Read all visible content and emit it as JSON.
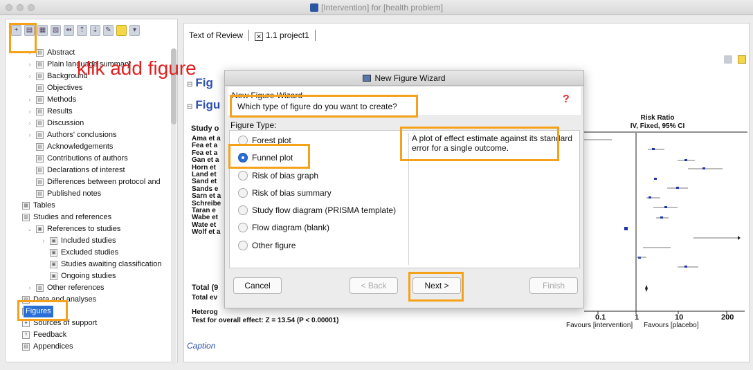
{
  "window": {
    "title": "[Intervention] for [health problem]"
  },
  "annotation": "klik add figure",
  "tabs": [
    {
      "label": "Text of Review"
    },
    {
      "label": "1.1 project1"
    }
  ],
  "tree": [
    {
      "label": "Abstract",
      "icon": "section-icon",
      "level": 1,
      "chevron": ">"
    },
    {
      "label": "Plain language summary",
      "icon": "section-icon",
      "level": 1,
      "chevron": ">"
    },
    {
      "label": "Background",
      "icon": "section-icon",
      "level": 1,
      "chevron": ">"
    },
    {
      "label": "Objectives",
      "icon": "section-icon",
      "level": 1,
      "chevron": ""
    },
    {
      "label": "Methods",
      "icon": "section-icon",
      "level": 1,
      "chevron": ">"
    },
    {
      "label": "Results",
      "icon": "section-icon",
      "level": 1,
      "chevron": ">"
    },
    {
      "label": "Discussion",
      "icon": "section-icon",
      "level": 1,
      "chevron": ">"
    },
    {
      "label": "Authors' conclusions",
      "icon": "section-icon",
      "level": 1,
      "chevron": ">"
    },
    {
      "label": "Acknowledgements",
      "icon": "section-icon",
      "level": 1,
      "chevron": ""
    },
    {
      "label": "Contributions of authors",
      "icon": "section-icon",
      "level": 1,
      "chevron": ""
    },
    {
      "label": "Declarations of interest",
      "icon": "section-icon",
      "level": 1,
      "chevron": ""
    },
    {
      "label": "Differences between protocol and",
      "icon": "section-icon",
      "level": 1,
      "chevron": ""
    },
    {
      "label": "Published notes",
      "icon": "section-icon",
      "level": 1,
      "chevron": ""
    },
    {
      "label": "Tables",
      "icon": "table-icon",
      "level": 0,
      "chevron": ""
    },
    {
      "label": "Studies and references",
      "icon": "book-icon",
      "level": 0,
      "chevron": ""
    },
    {
      "label": "References to studies",
      "icon": "references-icon",
      "level": 1,
      "chevron": "v"
    },
    {
      "label": "Included studies",
      "icon": "studies-icon",
      "level": 2,
      "chevron": ">"
    },
    {
      "label": "Excluded studies",
      "icon": "studies-icon",
      "level": 2,
      "chevron": ""
    },
    {
      "label": "Studies awaiting classification",
      "icon": "studies-icon",
      "level": 2,
      "chevron": ""
    },
    {
      "label": "Ongoing studies",
      "icon": "studies-icon",
      "level": 2,
      "chevron": ""
    },
    {
      "label": "Other references",
      "icon": "book-icon",
      "level": 1,
      "chevron": ">"
    },
    {
      "label": "Data and analyses",
      "icon": "chart-icon",
      "level": 0,
      "chevron": ""
    },
    {
      "label": "Figures",
      "icon": "figures-icon",
      "level": 0,
      "chevron": "",
      "selected": true
    },
    {
      "label": "Sources of support",
      "icon": "support-icon",
      "level": 0,
      "chevron": ""
    },
    {
      "label": "Feedback",
      "icon": "feedback-icon",
      "level": 0,
      "chevron": ""
    },
    {
      "label": "Appendices",
      "icon": "section-icon",
      "level": 0,
      "chevron": ""
    }
  ],
  "document": {
    "heading1": "Fig",
    "heading2": "Figu",
    "study_header": "Study o",
    "studies": [
      "Ama et a",
      "Fea et a",
      "Fea et a",
      "Gan et a",
      "Horn et",
      "Land et",
      "Sand et",
      "Sands e",
      "Sarn et a",
      "Schreibe",
      "Taran e",
      "Wabe et",
      "Wate et",
      "Wolf et a"
    ],
    "total": "Total (9",
    "total_events": "Total ev",
    "heterogeneity": "Heterog",
    "overall_effect": "Test for overall effect: Z = 13.54 (P < 0.00001)",
    "rr_title": "Risk Ratio",
    "rr_subtitle": "IV, Fixed, 95% CI",
    "axis_ticks": [
      "0.1",
      "1",
      "10",
      "200"
    ],
    "axis_left": "Favours [intervention]",
    "axis_right": "Favours [placebo]",
    "caption": "Caption"
  },
  "dialog": {
    "title": "New Figure Wizard",
    "header_title": "New Figure Wizard",
    "question": "Which type of figure do you want to create?",
    "figure_type_label": "Figure Type:",
    "options": [
      {
        "label": "Forest plot",
        "selected": false
      },
      {
        "label": "Funnel plot",
        "selected": true
      },
      {
        "label": "Risk of bias graph",
        "selected": false
      },
      {
        "label": "Risk of bias summary",
        "selected": false
      },
      {
        "label": "Study flow diagram (PRISMA template)",
        "selected": false
      },
      {
        "label": "Flow diagram (blank)",
        "selected": false
      },
      {
        "label": "Other figure",
        "selected": false
      }
    ],
    "description": "A plot of effect estimate against its standard error for a single outcome.",
    "buttons": {
      "cancel": "Cancel",
      "back": "< Back",
      "next": "Next >",
      "finish": "Finish"
    }
  },
  "colors": {
    "highlight": "#f5a21a",
    "annotation": "#e02020",
    "selection": "#2a6fd6",
    "accent": "#3050b0"
  }
}
